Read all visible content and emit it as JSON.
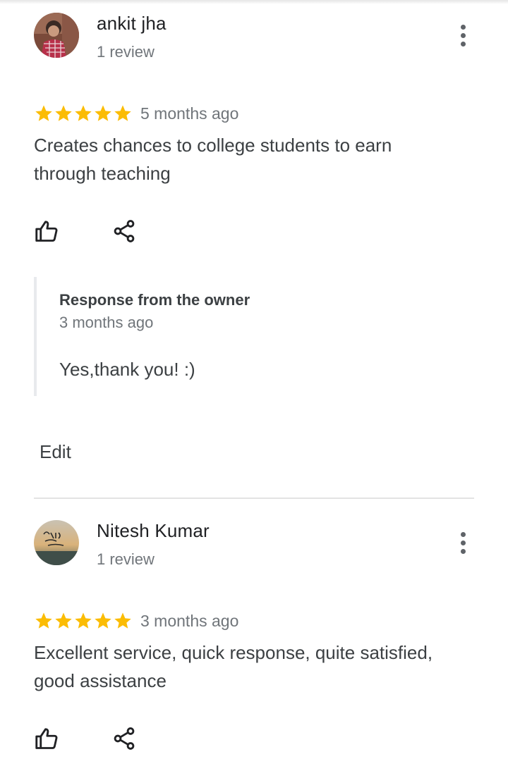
{
  "colors": {
    "star": "#fbbc04",
    "text": "#3c4043",
    "secondary_text": "#70757a",
    "icon": "#202124"
  },
  "reviews": [
    {
      "author": "ankit jha",
      "review_count": "1 review",
      "rating": 5,
      "time_ago": "5 months ago",
      "text": "Creates chances to college students to earn through teaching",
      "owner_response": {
        "title": "Response from the owner",
        "time_ago": "3 months ago",
        "text": "Yes,thank you! :)"
      },
      "edit_label": "Edit",
      "icons": {
        "like": "thumbs-up-icon",
        "share": "share-icon",
        "more": "more-vert-icon"
      }
    },
    {
      "author": "Nitesh Kumar",
      "review_count": "1 review",
      "rating": 5,
      "time_ago": "3 months ago",
      "text": "Excellent service, quick response, quite satisfied, good assistance",
      "icons": {
        "like": "thumbs-up-icon",
        "share": "share-icon",
        "more": "more-vert-icon"
      }
    }
  ]
}
